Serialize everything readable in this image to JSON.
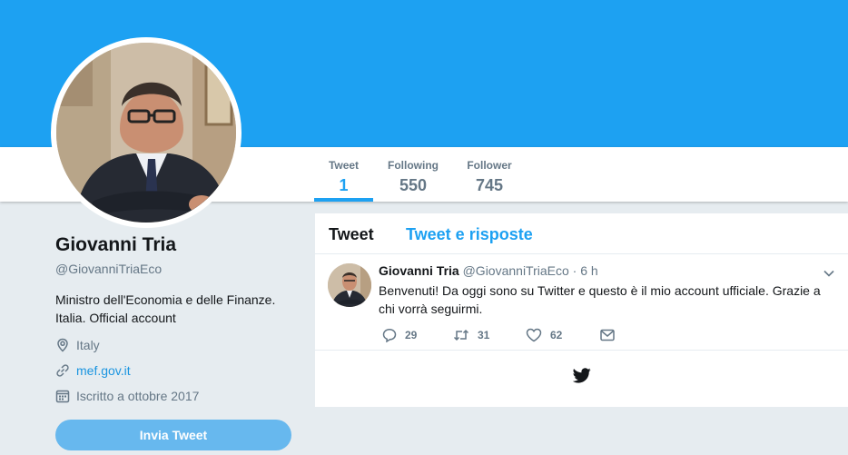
{
  "profile": {
    "name": "Giovanni Tria",
    "handle": "@GiovanniTriaEco",
    "bio": "Ministro dell'Economia e delle Finanze. Italia. Official account",
    "location": "Italy",
    "website": "mef.gov.it",
    "joined": "Iscritto a ottobre 2017",
    "tweet_button": "Invia Tweet"
  },
  "nav": {
    "items": [
      {
        "label": "Tweet",
        "value": "1"
      },
      {
        "label": "Following",
        "value": "550"
      },
      {
        "label": "Follower",
        "value": "745"
      }
    ]
  },
  "timeline": {
    "tabs": [
      "Tweet",
      "Tweet e risposte"
    ],
    "tweet": {
      "name": "Giovanni Tria",
      "handle": "@GiovanniTriaEco",
      "separator": "·",
      "time": "6 h",
      "text": "Benvenuti!  Da oggi sono su Twitter e questo è il mio account ufficiale. Grazie a chi vorrà seguirmi.",
      "replies": "29",
      "retweets": "31",
      "likes": "62"
    }
  },
  "icons": {
    "location": "location-pin-icon",
    "link": "link-icon",
    "calendar": "calendar-icon",
    "reply": "reply-icon",
    "retweet": "retweet-icon",
    "like": "heart-icon",
    "dm": "envelope-icon",
    "caret": "chevron-down-icon",
    "footer": "twitter-bird-icon"
  },
  "colors": {
    "brand": "#1da1f2",
    "background": "#e6ecf0",
    "button": "#67b8ee",
    "link": "#1b95e0",
    "muted": "#657786"
  }
}
